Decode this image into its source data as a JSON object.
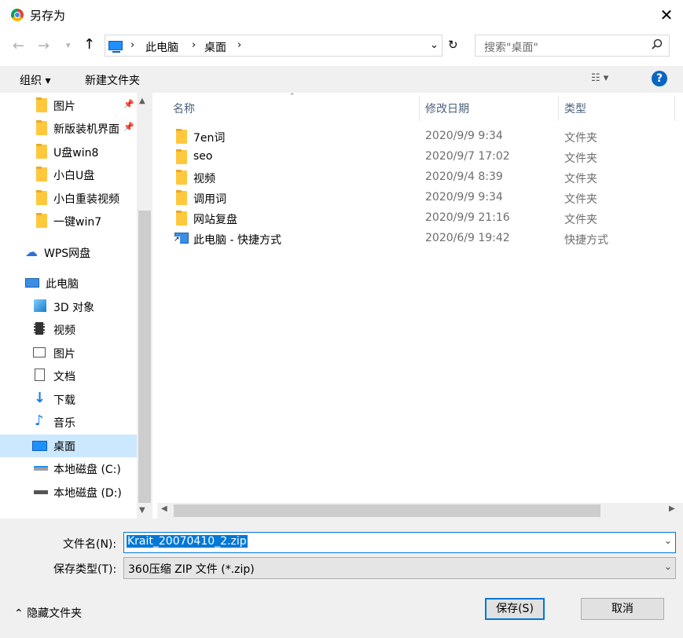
{
  "window": {
    "title": "另存为"
  },
  "address": {
    "crumbs": [
      "此电脑",
      "桌面"
    ],
    "search_placeholder": "搜索\"桌面\""
  },
  "toolbar": {
    "organize": "组织 ▾",
    "new_folder": "新建文件夹"
  },
  "nav": {
    "items": [
      {
        "label": "图片",
        "pinned": true
      },
      {
        "label": "新版装机界面",
        "pinned": true
      },
      {
        "label": "U盘win8"
      },
      {
        "label": "小白U盘"
      },
      {
        "label": "小白重装视频"
      },
      {
        "label": "一键win7"
      },
      {
        "label": "WPS网盘"
      },
      {
        "label": "此电脑"
      },
      {
        "label": "3D 对象"
      },
      {
        "label": "视频"
      },
      {
        "label": "图片"
      },
      {
        "label": "文档"
      },
      {
        "label": "下载"
      },
      {
        "label": "音乐"
      },
      {
        "label": "桌面"
      },
      {
        "label": "本地磁盘 (C:)"
      },
      {
        "label": "本地磁盘 (D:)"
      }
    ]
  },
  "columns": {
    "name": "名称",
    "date": "修改日期",
    "type": "类型"
  },
  "files": [
    {
      "name": "7en词",
      "date": "2020/9/9 9:34",
      "type": "文件夹"
    },
    {
      "name": "seo",
      "date": "2020/9/7 17:02",
      "type": "文件夹"
    },
    {
      "name": "视频",
      "date": "2020/9/4 8:39",
      "type": "文件夹"
    },
    {
      "name": "调用词",
      "date": "2020/9/9 9:34",
      "type": "文件夹"
    },
    {
      "name": "网站复盘",
      "date": "2020/9/9 21:16",
      "type": "文件夹"
    },
    {
      "name": "此电脑 - 快捷方式",
      "date": "2020/6/9 19:42",
      "type": "快捷方式"
    }
  ],
  "form": {
    "filename_label": "文件名(N):",
    "filename_value": "Krait_20070410_2.zip",
    "filetype_label": "保存类型(T):",
    "filetype_value": "360压缩 ZIP 文件 (*.zip)",
    "hide_folders": "隐藏文件夹",
    "save": "保存(S)",
    "cancel": "取消"
  }
}
